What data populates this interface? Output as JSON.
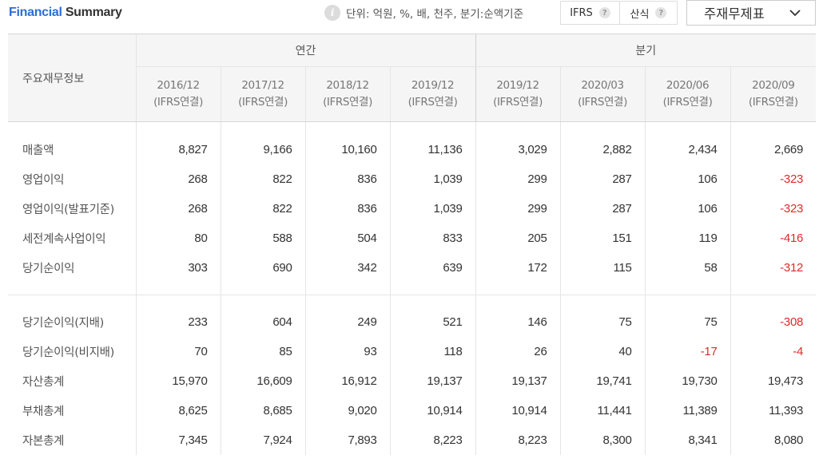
{
  "header": {
    "title_accent": "Financial",
    "title_rest": "Summary",
    "unit_text": "단위: 억원, %, 배, 천주, 분기:순액기준",
    "ifrs_label": "IFRS",
    "formula_label": "산식",
    "help_glyph": "?",
    "info_glyph": "i",
    "statement_select": "주재무제표"
  },
  "table": {
    "row_header_label": "주요재무정보",
    "groups": [
      {
        "label": "연간",
        "span": 4
      },
      {
        "label": "분기",
        "span": 4
      }
    ],
    "periods": [
      {
        "date": "2016/12",
        "basis": "(IFRS연결)"
      },
      {
        "date": "2017/12",
        "basis": "(IFRS연결)"
      },
      {
        "date": "2018/12",
        "basis": "(IFRS연결)"
      },
      {
        "date": "2019/12",
        "basis": "(IFRS연결)"
      },
      {
        "date": "2019/12",
        "basis": "(IFRS연결)"
      },
      {
        "date": "2020/03",
        "basis": "(IFRS연결)"
      },
      {
        "date": "2020/06",
        "basis": "(IFRS연결)"
      },
      {
        "date": "2020/09",
        "basis": "(IFRS연결)"
      }
    ],
    "section1": [
      {
        "label": "매출액",
        "values": [
          "8,827",
          "9,166",
          "10,160",
          "11,136",
          "3,029",
          "2,882",
          "2,434",
          "2,669"
        ]
      },
      {
        "label": "영업이익",
        "values": [
          "268",
          "822",
          "836",
          "1,039",
          "299",
          "287",
          "106",
          "-323"
        ]
      },
      {
        "label": "영업이익(발표기준)",
        "values": [
          "268",
          "822",
          "836",
          "1,039",
          "299",
          "287",
          "106",
          "-323"
        ]
      },
      {
        "label": "세전계속사업이익",
        "values": [
          "80",
          "588",
          "504",
          "833",
          "205",
          "151",
          "119",
          "-416"
        ]
      },
      {
        "label": "당기순이익",
        "values": [
          "303",
          "690",
          "342",
          "639",
          "172",
          "115",
          "58",
          "-312"
        ]
      }
    ],
    "section2": [
      {
        "label": "당기순이익(지배)",
        "values": [
          "233",
          "604",
          "249",
          "521",
          "146",
          "75",
          "75",
          "-308"
        ]
      },
      {
        "label": "당기순이익(비지배)",
        "values": [
          "70",
          "85",
          "93",
          "118",
          "26",
          "40",
          "-17",
          "-4"
        ]
      },
      {
        "label": "자산총계",
        "values": [
          "15,970",
          "16,609",
          "16,912",
          "19,137",
          "19,137",
          "19,741",
          "19,730",
          "19,473"
        ]
      },
      {
        "label": "부채총계",
        "values": [
          "8,625",
          "8,685",
          "9,020",
          "10,914",
          "10,914",
          "11,441",
          "11,389",
          "11,393"
        ]
      },
      {
        "label": "자본총계",
        "values": [
          "7,345",
          "7,924",
          "7,893",
          "8,223",
          "8,223",
          "8,300",
          "8,341",
          "8,080"
        ]
      }
    ],
    "colors": {
      "negative": "#e0292c",
      "accent": "#2b6fd6"
    }
  }
}
